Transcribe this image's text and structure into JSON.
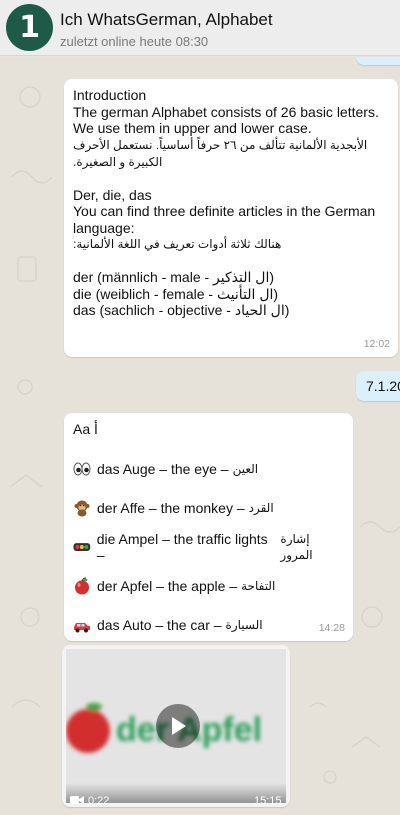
{
  "header": {
    "avatar_text": "1",
    "title": "Ich WhatsGerman, Alphabet",
    "status": "zuletzt online heute 08:30"
  },
  "messages": {
    "intro": {
      "lines": [
        "Introduction",
        "The german Alphabet consists of 26 basic letters.",
        "We use them in upper and lower case."
      ],
      "arabic_1": "الأبجدية الألمانية تتألف من ٢٦ حرفاً أساسياً. نستعمل الأحرف الكبيرة و الصغيرة.",
      "articles_title": "Der, die, das",
      "articles_en": "You can find three definite articles in the German language:",
      "articles_ar": "هنالك ثلاثة أدوات تعريف في اللغة الألمانية:",
      "article_lines": [
        "der (männlich - male - ال التذكير)",
        "die (weiblich - female - ال التأنيث)",
        "das (sachlich - objective - ال الحياد)"
      ],
      "time": "12:02"
    },
    "date_out": {
      "text": "7.1.20"
    },
    "alphabet_a": {
      "heading": "Aa أ",
      "words": [
        {
          "icon": "eyes-emoji",
          "text": "das Auge – the eye –",
          "ar": "العين"
        },
        {
          "icon": "monkey-emoji",
          "text": "der Affe – the monkey –",
          "ar": "القرد"
        },
        {
          "icon": "traffic-light-emoji",
          "text": "die Ampel – the traffic lights –",
          "ar": "إشارة المرور"
        },
        {
          "icon": "apple-emoji",
          "text": "der Apfel – the apple –",
          "ar": "التفاحة"
        },
        {
          "icon": "car-emoji",
          "text": "das Auto – the car –",
          "ar": "السيارة"
        }
      ],
      "time": "14:28"
    },
    "video": {
      "thumbnail_text": "der Apfel",
      "duration": "0:22",
      "time": "15:15"
    }
  },
  "colors": {
    "header_bg": "#ededed",
    "avatar_bg": "#1d5a48",
    "incoming_bubble": "#ffffff",
    "outgoing_bubble": "#dcf0fb",
    "chat_bg": "#e6e1d9"
  }
}
